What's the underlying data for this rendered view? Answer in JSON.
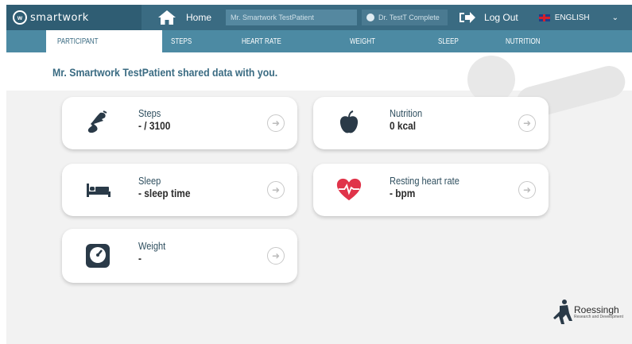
{
  "header": {
    "logo_mark": "w",
    "logo_text": "smartwork",
    "home_label": "Home",
    "patient_selector": "Mr. Smartwork TestPatient",
    "therapist": "Dr. TestT Complete",
    "logout_label": "Log Out",
    "language": "ENGLISH"
  },
  "tabs": [
    {
      "label": "PARTICIPANT",
      "active": true
    },
    {
      "label": "STEPS"
    },
    {
      "label": "HEART RATE"
    },
    {
      "label": "WEIGHT"
    },
    {
      "label": "SLEEP"
    },
    {
      "label": "NUTRITION"
    }
  ],
  "main": {
    "shared_message": "Mr. Smartwork TestPatient shared data with you.",
    "cards": [
      {
        "label": "Steps",
        "value": "- / 3100",
        "icon": "running-shoe-icon"
      },
      {
        "label": "Nutrition",
        "value": "0 kcal",
        "icon": "apple-icon"
      },
      {
        "label": "Sleep",
        "value": "- sleep time",
        "icon": "bed-icon"
      },
      {
        "label": "Resting heart rate",
        "value": "- bpm",
        "icon": "heart-pulse-icon"
      },
      {
        "label": "Weight",
        "value": "-",
        "icon": "scale-icon"
      }
    ]
  },
  "footer": {
    "brand": "Roessingh",
    "brand_sub": "Research and Development"
  },
  "colors": {
    "topbar": "#3a6b82",
    "tabbar": "#4c8aa3",
    "accent_red": "#e0344a",
    "icon_dark": "#2a3a48"
  }
}
